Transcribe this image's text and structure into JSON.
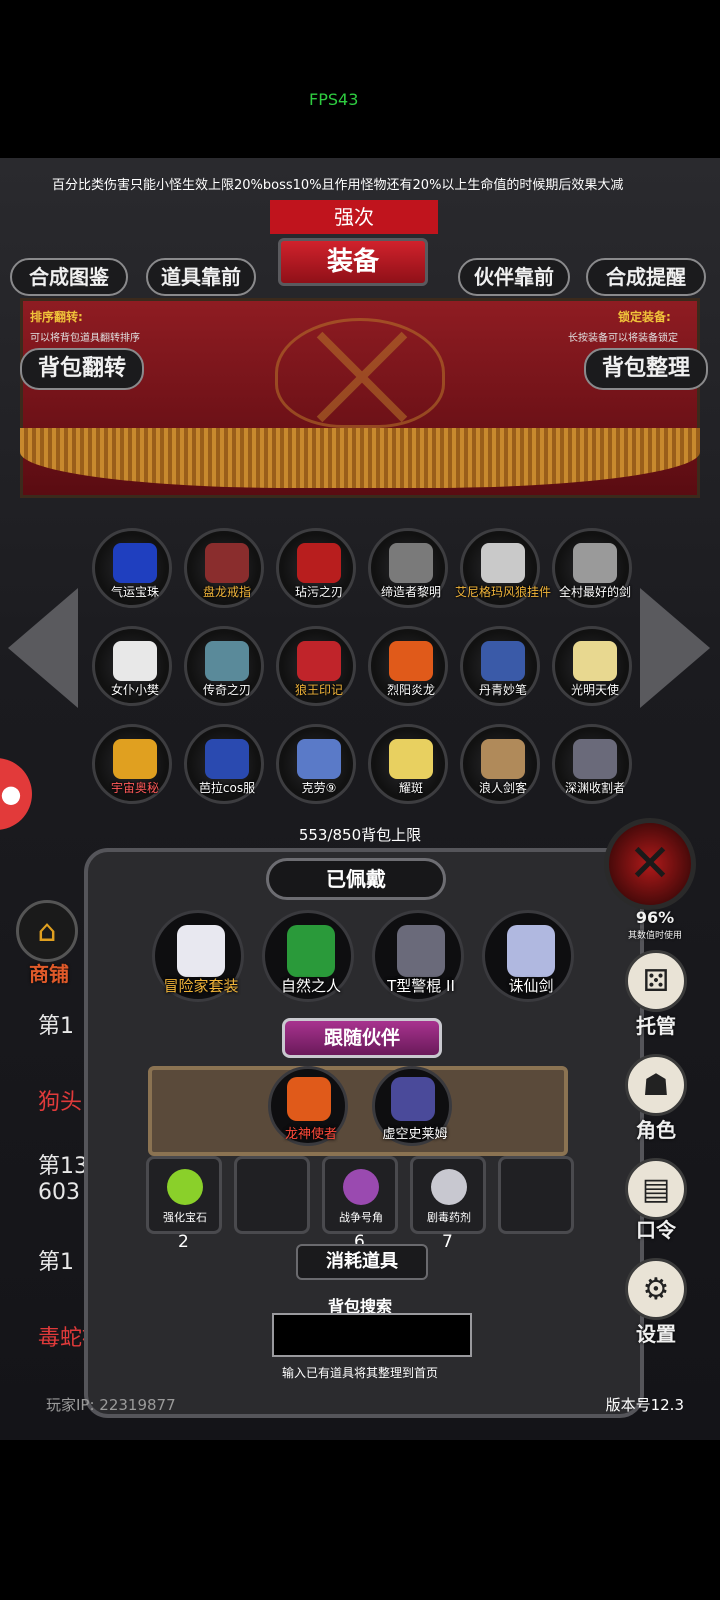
{
  "status": {
    "fps": "FPS43"
  },
  "notice": "百分比类伤害只能小怪生效上限20%boss10%且作用怪物还有20%以上生命值的时候期后效果大减",
  "header": {
    "top_title": "强次",
    "title": "装备",
    "tabs": [
      "合成图鉴",
      "道具靠前",
      "伙伴靠前",
      "合成提醒"
    ],
    "sort_label": "排序翻转:",
    "sort_hint": "可以将背包道具翻转排序",
    "lock_label": "锁定装备:",
    "lock_hint": "长按装备可以将装备锁定",
    "flip_button": "背包翻转",
    "arrange_button": "背包整理"
  },
  "inventory": {
    "items": [
      {
        "label": "气运宝珠",
        "color": "#ffffff",
        "art": "#1f3fbf"
      },
      {
        "label": "盘龙戒指",
        "color": "#f0b43a",
        "art": "#8a2d2d"
      },
      {
        "label": "玷污之刃",
        "color": "#ffffff",
        "art": "#b81e1e"
      },
      {
        "label": "缔造者黎明",
        "color": "#ffffff",
        "art": "#7a7a7a"
      },
      {
        "label": "艾尼格玛风狼挂件",
        "color": "#f0b43a",
        "art": "#c9c9c9"
      },
      {
        "label": "全村最好的剑",
        "color": "#ffffff",
        "art": "#9a9a9a"
      },
      {
        "label": "女仆小樊",
        "color": "#ffffff",
        "art": "#e8e8e8"
      },
      {
        "label": "传奇之刃",
        "color": "#ffffff",
        "art": "#5a8a9a"
      },
      {
        "label": "狼王印记",
        "color": "#f0b43a",
        "art": "#c0242a"
      },
      {
        "label": "烈阳炎龙",
        "color": "#ffffff",
        "art": "#e05a1a"
      },
      {
        "label": "丹青妙笔",
        "color": "#ffffff",
        "art": "#3a5aa8"
      },
      {
        "label": "光明天使",
        "color": "#ffffff",
        "art": "#e8d890"
      },
      {
        "label": "宇宙奥秘",
        "color": "#ff5a5a",
        "art": "#e0a020"
      },
      {
        "label": "芭拉cos服",
        "color": "#ffffff",
        "art": "#2a4ab0"
      },
      {
        "label": "克劳⑨",
        "color": "#ffffff",
        "art": "#5a7ac8"
      },
      {
        "label": "耀斑",
        "color": "#ffffff",
        "art": "#e8d060"
      },
      {
        "label": "浪人剑客",
        "color": "#ffffff",
        "art": "#b08a5a"
      },
      {
        "label": "深渊收割者",
        "color": "#ffffff",
        "art": "#6a6a7a"
      }
    ],
    "capacity": "553/850背包上限"
  },
  "equipped": {
    "title": "已佩戴",
    "items": [
      {
        "label": "冒险家套装",
        "color": "#f0b43a",
        "art": "#e8e8f0"
      },
      {
        "label": "自然之人",
        "color": "#ffffff",
        "art": "#2a9a3a"
      },
      {
        "label": "T型警棍 II",
        "color": "#ffffff",
        "art": "#6a6a7a"
      },
      {
        "label": "诛仙剑",
        "color": "#ffffff",
        "art": "#b0b8e0"
      }
    ]
  },
  "companions": {
    "title": "跟随伙伴",
    "items": [
      {
        "label": "龙神使者",
        "color": "#ff4a3a",
        "art": "#e05a1a"
      },
      {
        "label": "虚空史莱姆",
        "color": "#ffffff",
        "art": "#4a4a9a"
      }
    ]
  },
  "consumables": {
    "title": "消耗道具",
    "slots": [
      {
        "label": "强化宝石",
        "count": "2",
        "art": "#8ad02a"
      },
      {
        "label": "",
        "count": "",
        "art": ""
      },
      {
        "label": "战争号角",
        "count": "6",
        "art": "#9a4ab0"
      },
      {
        "label": "剧毒药剂",
        "count": "7",
        "art": "#c8c8d0"
      },
      {
        "label": "",
        "count": "",
        "art": ""
      }
    ]
  },
  "search": {
    "label": "背包搜索",
    "placeholder": "",
    "hint": "输入已有道具将其整理到首页"
  },
  "background": {
    "shop_label": "商铺",
    "line1": "第1",
    "line2": "狗头",
    "line3": "第13",
    "line4": "603",
    "line5": "第1",
    "drop_text": "毒蛇被击败掉落金",
    "player_ip": "玩家IP:  22319877",
    "version": "版本号12.3",
    "percent": "96%",
    "percent_hint": "其数值时使用"
  },
  "side_menu": {
    "items": [
      "托管",
      "角色",
      "口令",
      "设置"
    ]
  },
  "icons": {
    "close": "close-x-icon",
    "gear": "gear-icon",
    "dice": "dice-icon",
    "hood": "hooded-figure-icon",
    "book": "book-icon",
    "avatar": "avatar-icon",
    "shop": "shop-icon"
  }
}
